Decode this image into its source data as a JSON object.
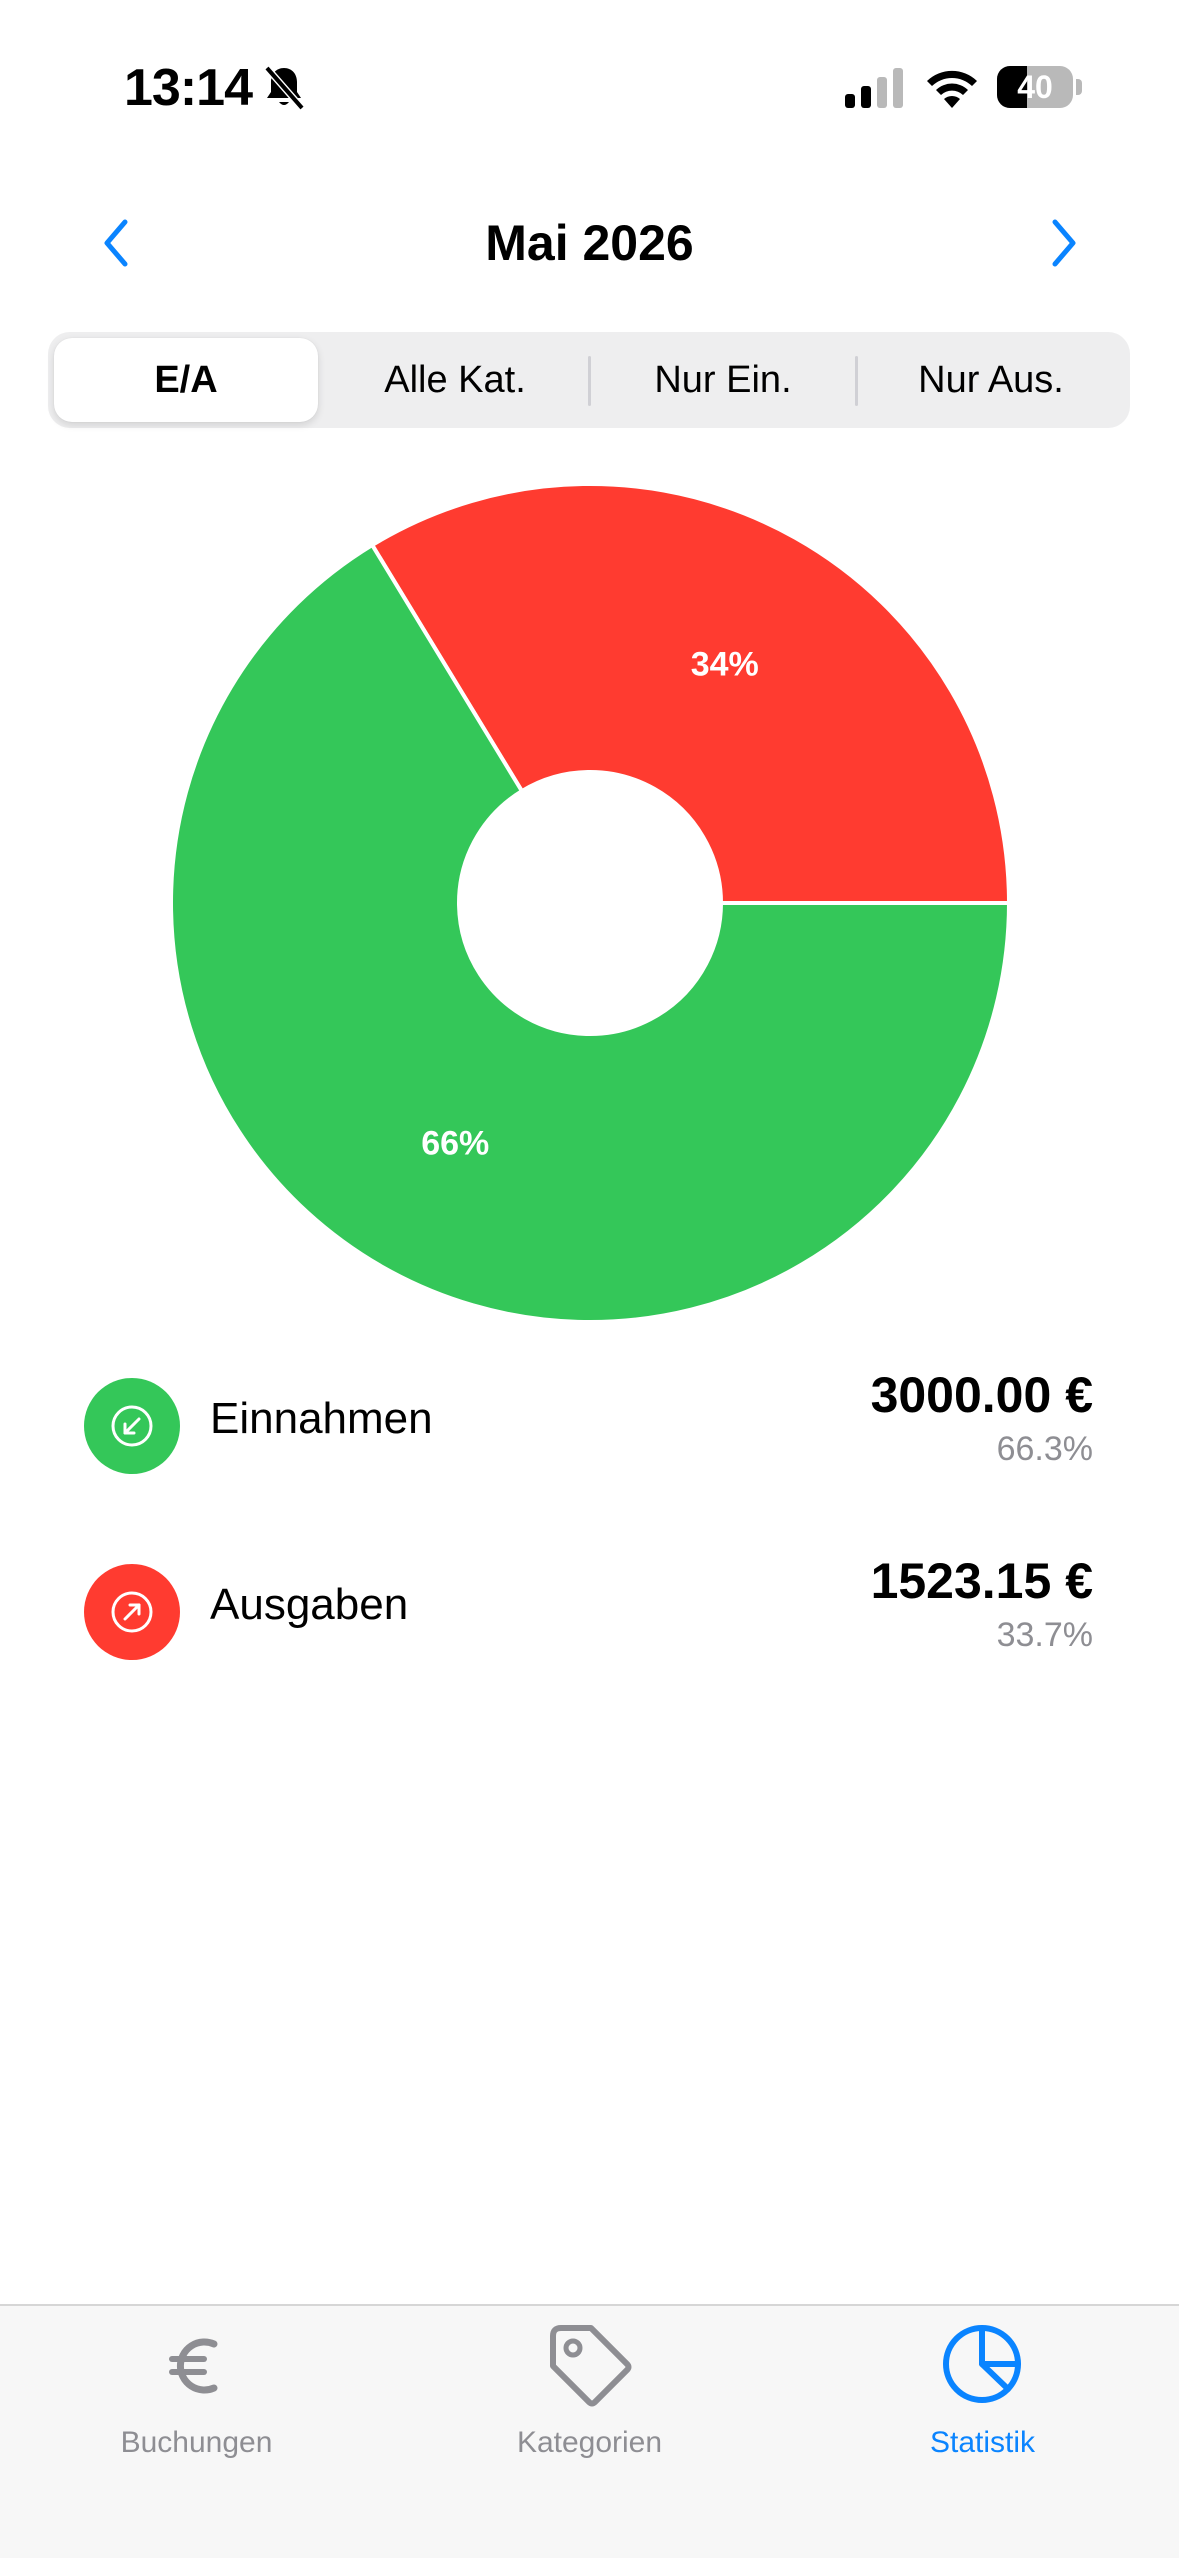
{
  "status_bar": {
    "time": "13:14",
    "battery_level": "40",
    "battery_fraction": 0.4,
    "icons": [
      "bell-slash-icon",
      "cellular-signal-icon",
      "wifi-icon",
      "battery-icon"
    ]
  },
  "header": {
    "title": "Mai 2026",
    "prev_icon": "chevron-left-icon",
    "next_icon": "chevron-right-icon"
  },
  "segments": [
    {
      "label": "E/A",
      "selected": true
    },
    {
      "label": "Alle Kat.",
      "selected": false
    },
    {
      "label": "Nur Ein.",
      "selected": false
    },
    {
      "label": "Nur Aus.",
      "selected": false
    }
  ],
  "chart_data": {
    "type": "pie",
    "categories": [
      "Einnahmen",
      "Ausgaben"
    ],
    "values": [
      66.3,
      33.7
    ],
    "slice_labels": [
      "66%",
      "34%"
    ],
    "colors": [
      "#34c759",
      "#ff3b30"
    ],
    "donut": true
  },
  "legend": [
    {
      "label": "Einnahmen",
      "amount": "3000.00 €",
      "percent": "66.3%",
      "color": "#34c759",
      "icon": "arrow-down-left-circle-icon"
    },
    {
      "label": "Ausgaben",
      "amount": "1523.15 €",
      "percent": "33.7%",
      "color": "#ff3b30",
      "icon": "arrow-up-right-circle-icon"
    }
  ],
  "tabs": [
    {
      "label": "Buchungen",
      "icon": "euro-icon",
      "active": false
    },
    {
      "label": "Kategorien",
      "icon": "tag-icon",
      "active": false
    },
    {
      "label": "Statistik",
      "icon": "pie-chart-icon",
      "active": true
    }
  ],
  "colors": {
    "accent": "#0a84ff",
    "income": "#34c759",
    "expense": "#ff3b30",
    "secondary_text": "#8e8e93"
  }
}
